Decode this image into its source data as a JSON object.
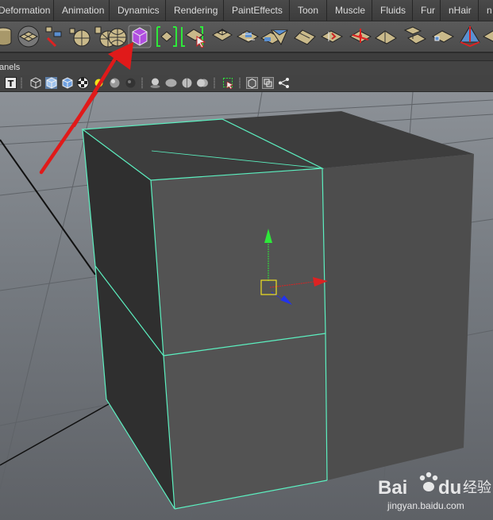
{
  "menu_tabs": [
    "Deformation",
    "Animation",
    "Dynamics",
    "Rendering",
    "PaintEffects",
    "Toon",
    "Muscle",
    "Fluids",
    "Fur",
    "nHair",
    "n"
  ],
  "panel_menu": {
    "label": "anels"
  },
  "text_tool_glyph": "T",
  "watermark": {
    "brand": "Bai",
    "brand2": "du",
    "cn": "经验",
    "url": "jingyan.baidu.com"
  },
  "colors": {
    "selection_wire": "#5cf0c0",
    "arrow": "#e01a1a",
    "highlight_icon": "#b04ee0"
  },
  "shelf_icons": [
    "cylinder-icon",
    "plane-icon",
    "cone-icon",
    "sphere-icon",
    "nurbs-sphere-icon",
    "sphere-grid-icon",
    "cube-icon",
    "polygon-cube-icon",
    "selection-bracket-icon",
    "select-face-icon",
    "extrude-icon",
    "split-icon",
    "append-icon",
    "wedge-icon",
    "bevel-icon",
    "bridge-icon",
    "poke-icon",
    "merge-icon",
    "cut-icon",
    "duplicate-icon",
    "flip-icon",
    "extract-icon",
    "smooth-icon",
    "cone-tool-icon"
  ]
}
